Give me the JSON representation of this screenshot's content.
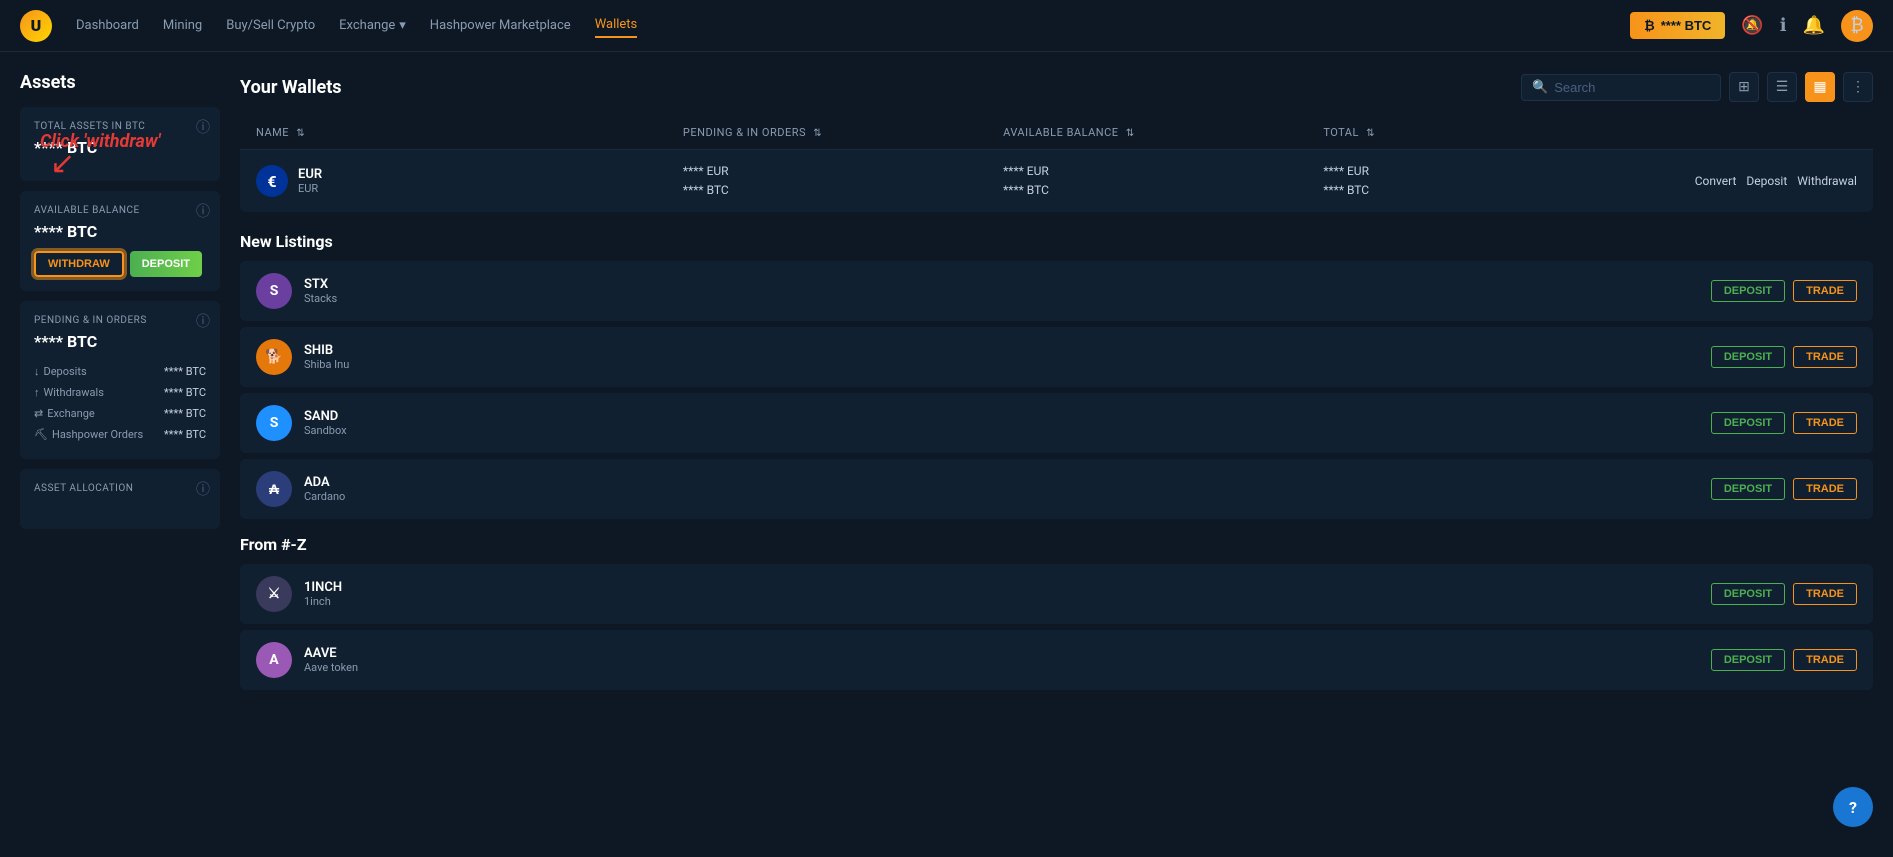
{
  "brand": {
    "logo_letter": "U",
    "btc_button_label": "**** BTC"
  },
  "navbar": {
    "items": [
      {
        "id": "dashboard",
        "label": "Dashboard",
        "active": false
      },
      {
        "id": "mining",
        "label": "Mining",
        "active": false
      },
      {
        "id": "buy-sell",
        "label": "Buy/Sell Crypto",
        "active": false
      },
      {
        "id": "exchange",
        "label": "Exchange",
        "active": false,
        "has_dropdown": true
      },
      {
        "id": "hashpower",
        "label": "Hashpower Marketplace",
        "active": false
      },
      {
        "id": "wallets",
        "label": "Wallets",
        "active": true
      }
    ]
  },
  "sidebar": {
    "title": "Assets",
    "total_assets": {
      "label": "TOTAL ASSETS IN BTC",
      "value": "**** BTC"
    },
    "available_balance": {
      "label": "AVAILABLE BALANCE",
      "value": "**** BTC",
      "withdraw_label": "WITHDRAW",
      "deposit_label": "DEPOSIT"
    },
    "pending": {
      "label": "PENDING & IN ORDERS",
      "value": "**** BTC",
      "rows": [
        {
          "icon": "↓",
          "label": "Deposits",
          "value": "**** BTC"
        },
        {
          "icon": "↑",
          "label": "Withdrawals",
          "value": "**** BTC"
        },
        {
          "icon": "⇄",
          "label": "Exchange",
          "value": "**** BTC"
        },
        {
          "icon": "⛏",
          "label": "Hashpower Orders",
          "value": "**** BTC"
        }
      ]
    },
    "asset_allocation_label": "ASSET ALLOCATION"
  },
  "wallets_section": {
    "title": "Your Wallets",
    "search_placeholder": "Search",
    "view_icons": [
      "grid",
      "list",
      "columns",
      "more"
    ],
    "table": {
      "headers": [
        {
          "id": "name",
          "label": "NAME"
        },
        {
          "id": "pending",
          "label": "PENDING & IN ORDERS"
        },
        {
          "id": "available",
          "label": "AVAILABLE BALANCE"
        },
        {
          "id": "total",
          "label": "TOTAL"
        },
        {
          "id": "actions",
          "label": ""
        }
      ],
      "rows": [
        {
          "icon": "€",
          "icon_class": "eur",
          "name": "EUR",
          "sub": "EUR",
          "pending_1": "**** EUR",
          "pending_2": "**** BTC",
          "available_1": "**** EUR",
          "available_2": "**** BTC",
          "total_1": "**** EUR",
          "total_2": "**** BTC",
          "actions": [
            "Convert",
            "Deposit",
            "Withdrawal"
          ]
        }
      ]
    }
  },
  "new_listings": {
    "title": "New Listings",
    "items": [
      {
        "id": "stx",
        "name": "STX",
        "sub": "Stacks",
        "color": "#6b3fa0",
        "icon_text": "S"
      },
      {
        "id": "shib",
        "name": "SHIB",
        "sub": "Shiba Inu",
        "color": "#e5780a",
        "icon_text": "🐕"
      },
      {
        "id": "sand",
        "name": "SAND",
        "sub": "Sandbox",
        "color": "#1e90ff",
        "icon_text": "S"
      },
      {
        "id": "ada",
        "name": "ADA",
        "sub": "Cardano",
        "color": "#2c3e7a",
        "icon_text": "₳"
      }
    ],
    "deposit_label": "DEPOSIT",
    "trade_label": "TRADE"
  },
  "from_az": {
    "title": "From #-Z",
    "items": [
      {
        "id": "1inch",
        "name": "1INCH",
        "sub": "1inch",
        "color": "#3a3a5c",
        "icon_text": "⚔"
      },
      {
        "id": "aave",
        "name": "AAVE",
        "sub": "Aave token",
        "color": "#9b59b6",
        "icon_text": "A"
      }
    ],
    "deposit_label": "DEPOSIT",
    "trade_label": "TRADE"
  },
  "annotation": {
    "text": "Click 'withdraw'",
    "color": "#e53935"
  },
  "help_label": "?"
}
